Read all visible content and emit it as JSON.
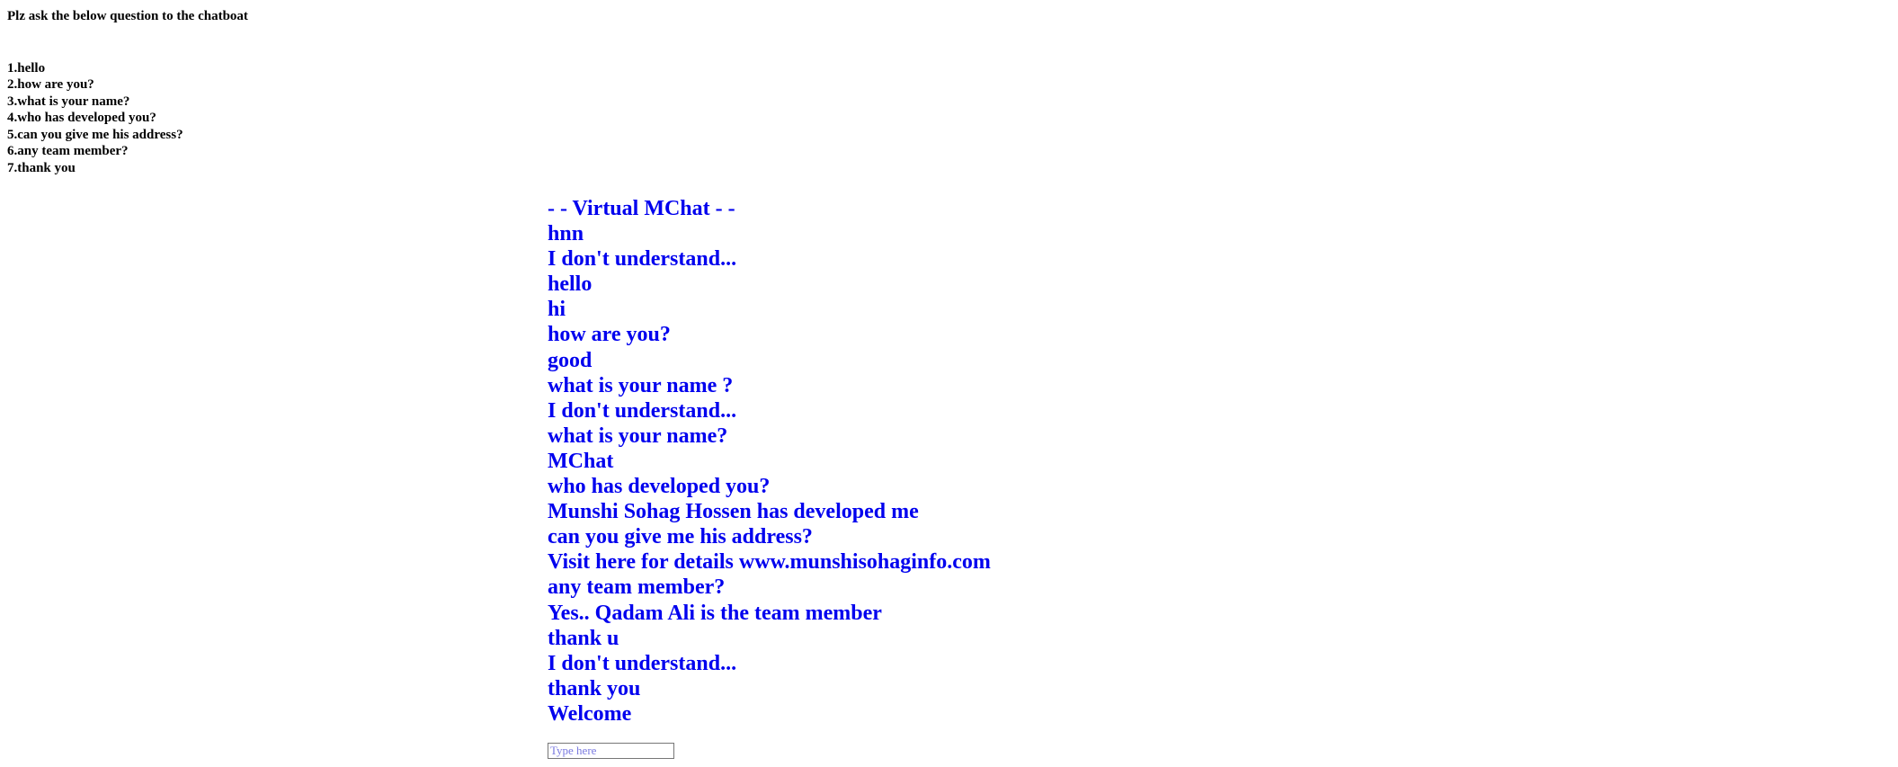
{
  "intro": {
    "title": "Plz ask the below question to the chatboat",
    "questions": [
      "1.hello",
      "2.how are you?",
      "3.what is your name?",
      "4.who has developed you?",
      "5.can you give me his address?",
      "6.any team member?",
      "7.thank you"
    ]
  },
  "chat": {
    "header": "- - Virtual MChat - -",
    "messages": [
      "hnn",
      "I don't understand...",
      "hello",
      "hi",
      "how are you?",
      "good",
      "what is your name ?",
      "I don't understand...",
      "what is your name?",
      "MChat",
      "who has developed you?",
      "Munshi Sohag Hossen has developed me",
      "can you give me his address?",
      "Visit here for details www.munshisohaginfo.com",
      "any team member?",
      "Yes.. Qadam Ali is the team member",
      "thank u",
      "I don't understand...",
      "thank you",
      "Welcome"
    ],
    "input": {
      "placeholder": "Type here",
      "value": ""
    }
  },
  "colors": {
    "chat_text": "#0000ee",
    "intro_text": "#000000",
    "background": "#ffffff"
  }
}
